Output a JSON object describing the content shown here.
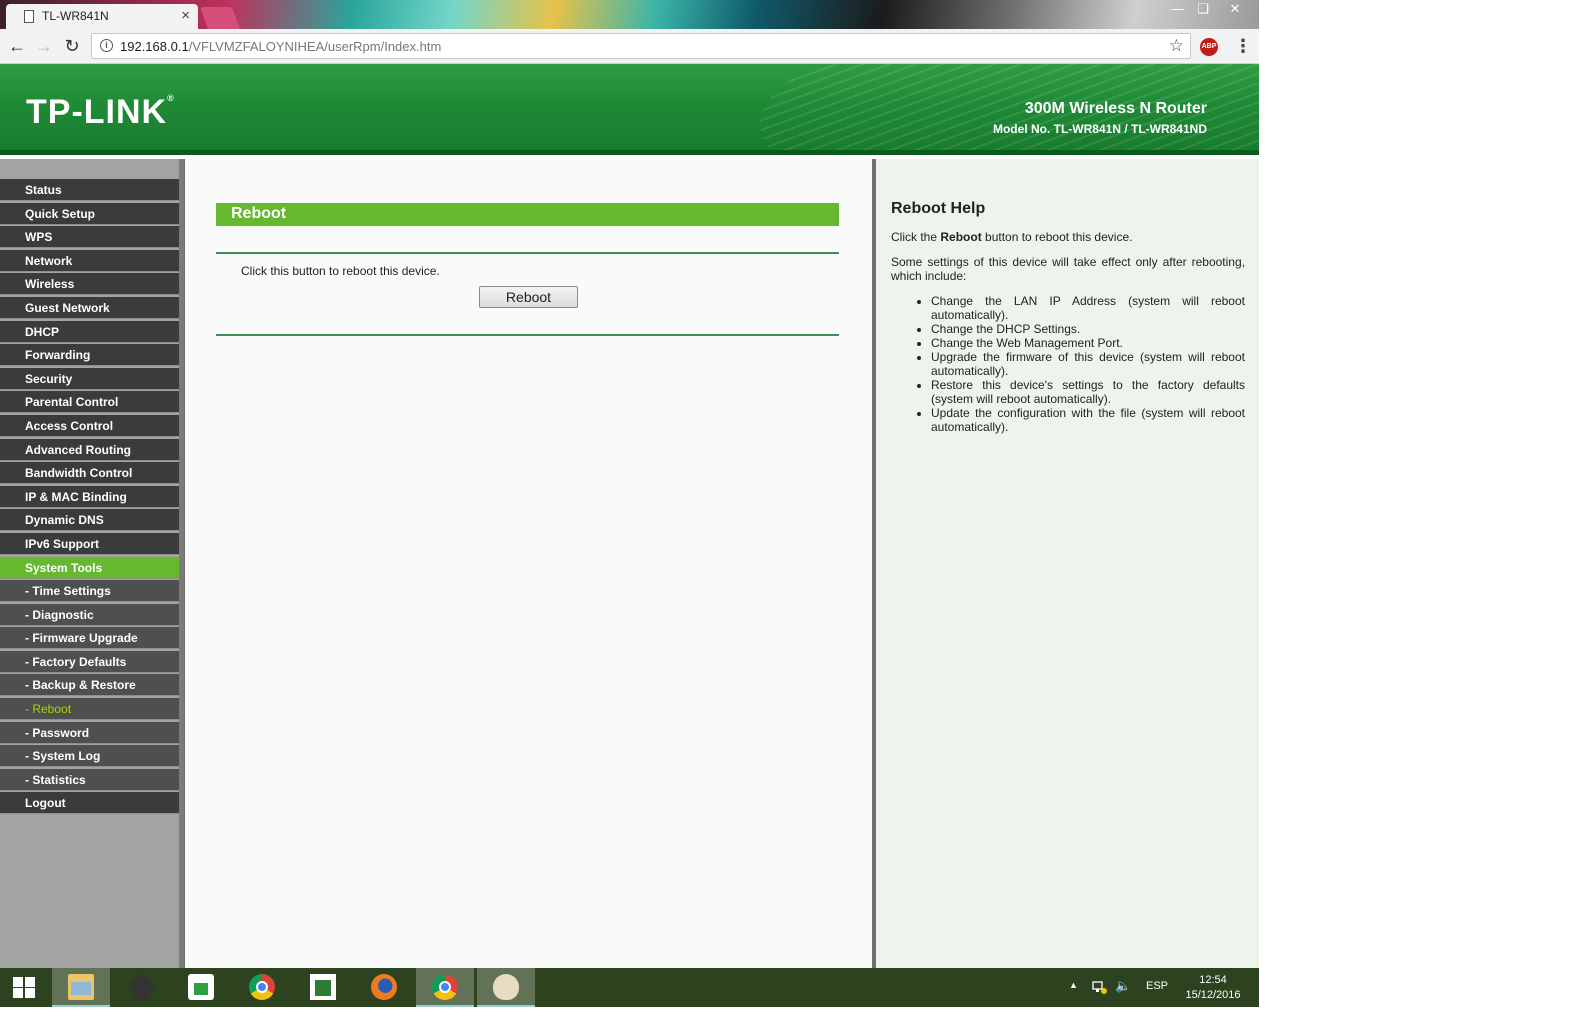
{
  "browser": {
    "tab_title": "TL-WR841N",
    "tab_close": "×",
    "url_host": "192.168.0.1",
    "url_path": "/VFLVMZFALOYNIHEA/userRpm/Index.htm",
    "abp_label": "ABP",
    "icons": [
      "back-icon",
      "forward-icon",
      "reload-icon",
      "info-icon",
      "star-icon",
      "adblock-icon",
      "chrome-menu-icon"
    ]
  },
  "router": {
    "logo": "TP-LINK",
    "logo_mark": "®",
    "product_name": "300M Wireless N Router",
    "model_no": "Model No. TL-WR841N / TL-WR841ND",
    "menu": [
      {
        "label": "Status"
      },
      {
        "label": "Quick Setup"
      },
      {
        "label": "WPS"
      },
      {
        "label": "Network"
      },
      {
        "label": "Wireless"
      },
      {
        "label": "Guest Network"
      },
      {
        "label": "DHCP"
      },
      {
        "label": "Forwarding"
      },
      {
        "label": "Security"
      },
      {
        "label": "Parental Control"
      },
      {
        "label": "Access Control"
      },
      {
        "label": "Advanced Routing"
      },
      {
        "label": "Bandwidth Control"
      },
      {
        "label": "IP & MAC Binding"
      },
      {
        "label": "Dynamic DNS"
      },
      {
        "label": "IPv6 Support"
      },
      {
        "label": "System Tools"
      },
      {
        "label": "- Time Settings"
      },
      {
        "label": "- Diagnostic"
      },
      {
        "label": "- Firmware Upgrade"
      },
      {
        "label": "- Factory Defaults"
      },
      {
        "label": "- Backup & Restore"
      },
      {
        "label": "- Reboot"
      },
      {
        "label": "- Password"
      },
      {
        "label": "- System Log"
      },
      {
        "label": "- Statistics"
      },
      {
        "label": "Logout"
      }
    ],
    "colors": {
      "header_green": "#1f8a36",
      "accent_green": "#66b82f",
      "current_item": "#a4d900",
      "menu_dark": "#3b3b3b"
    }
  },
  "content": {
    "title": "Reboot",
    "description": "Click this button to reboot this device.",
    "button_label": "Reboot"
  },
  "help": {
    "title": "Reboot Help",
    "intro_prefix": "Click the ",
    "intro_bold": "Reboot",
    "intro_suffix": " button to reboot this device.",
    "para": "Some settings of this device will take effect only after rebooting, which include:",
    "items": [
      "Change the LAN IP Address (system will reboot automatically).",
      "Change the DHCP Settings.",
      "Change the Web Management Port.",
      "Upgrade the firmware of this device (system will reboot automatically).",
      "Restore this device's settings to the factory defaults (system will reboot automatically).",
      "Update the configuration with the file (system will reboot automatically)."
    ]
  },
  "taskbar": {
    "language": "ESP",
    "time": "12:54",
    "date": "15/12/2016",
    "apps": [
      "start-icon",
      "file-explorer-icon",
      "app-icon",
      "store-icon",
      "chrome-icon",
      "project-icon",
      "firefox-icon",
      "chrome-icon",
      "paint-icon"
    ]
  }
}
